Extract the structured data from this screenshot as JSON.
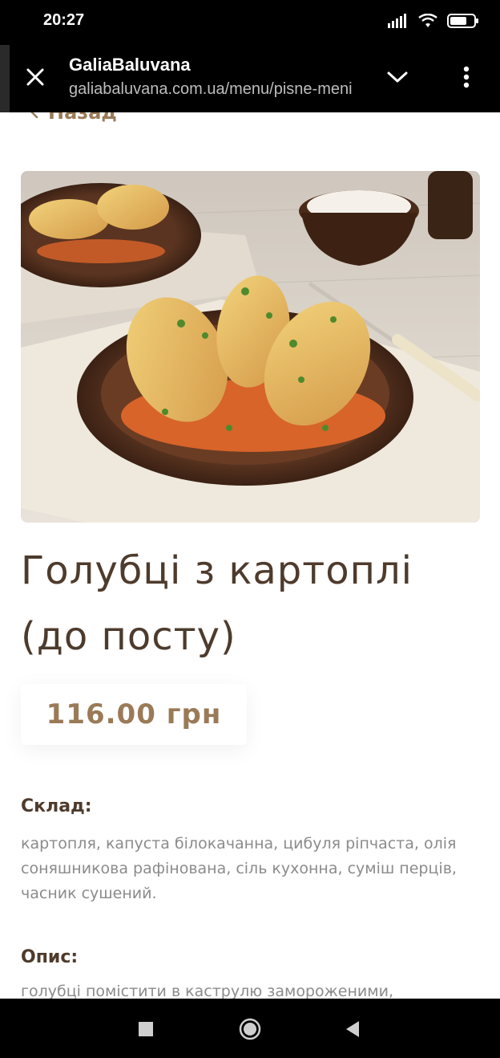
{
  "status_bar": {
    "time": "20:27",
    "icons": [
      "signal-icon",
      "wifi-icon",
      "battery-icon"
    ]
  },
  "browser": {
    "title": "GaliaBaluvana",
    "url": "galiabaluvana.com.ua/menu/pisne-meni",
    "icons": [
      "close-icon",
      "chevron-down-icon",
      "more-vert-icon"
    ]
  },
  "page": {
    "back_label": "Назад",
    "dish_title_line1": "Голубці з картоплі",
    "dish_title_line2": "(до посту)",
    "price": "116.00 грн",
    "ingredients_label": "Склад:",
    "ingredients_text": "картопля, капуста білокачанна, цибуля ріпчаста, олія соняшникова рафінована, сіль кухонна, суміш перців, часник сушений.",
    "description_label": "Опис:",
    "description_text": "голубці помістити в каструлю замороженими,"
  },
  "colors": {
    "accent": "#9a7a57",
    "title": "#4e3b2c",
    "body_text": "#8b8b8b"
  },
  "nav_bar": {
    "icons": [
      "recents-icon",
      "home-icon",
      "back-icon"
    ]
  }
}
